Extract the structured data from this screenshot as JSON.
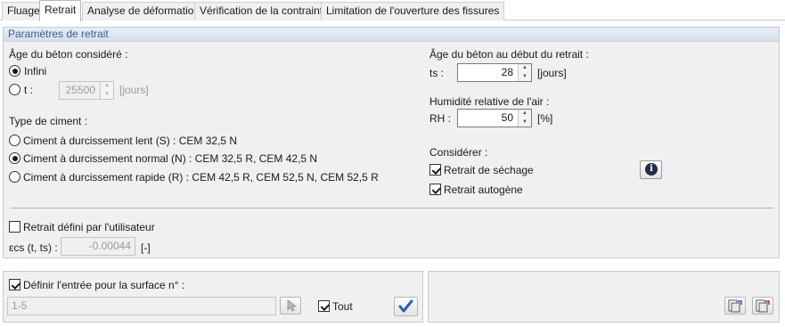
{
  "tabs": [
    {
      "label": "Fluage",
      "active": false
    },
    {
      "label": "Retrait",
      "active": true
    },
    {
      "label": "Analyse de déformation",
      "active": false
    },
    {
      "label": "Vérification de la contrainte",
      "active": false
    },
    {
      "label": "Limitation de l'ouverture des fissures",
      "active": false
    }
  ],
  "params": {
    "header": "Paramètres de retrait",
    "age": {
      "label": "Âge du béton considéré :",
      "infinite_label": "Infini",
      "infinite_selected": true,
      "t_label": "t :",
      "t_value": "25500",
      "t_unit": "[jours]"
    },
    "cement": {
      "label": "Type de ciment :",
      "options": [
        {
          "label": "Ciment à durcissement lent (S) : CEM 32,5 N",
          "selected": false
        },
        {
          "label": "Ciment à durcissement normal (N) : CEM 32,5 R, CEM 42,5 N",
          "selected": true
        },
        {
          "label": "Ciment à durcissement rapide (R) : CEM 42,5 R, CEM 52,5 N, CEM 52,5 R",
          "selected": false
        }
      ]
    },
    "ts": {
      "label": "Âge du béton au début du retrait :",
      "field_label": "ts :",
      "value": "28",
      "unit": "[jours]"
    },
    "rh": {
      "label": "Humidité relative de l'air :",
      "field_label": "RH :",
      "value": "50",
      "unit": "[%]"
    },
    "consider": {
      "label": "Considérer :",
      "drying_label": "Retrait de séchage",
      "drying_checked": true,
      "autogenous_label": "Retrait autogène",
      "autogenous_checked": true,
      "info_icon": "info-icon"
    },
    "user_defined": {
      "label": "Retrait défini par l'utilisateur",
      "checked": false,
      "eps_label": "εcs (t, ts) :",
      "eps_value": "-0.00044",
      "eps_unit": "[-]"
    }
  },
  "surface": {
    "label": "Définir l'entrée pour la surface n° :",
    "checked": true,
    "value": "1-5",
    "all_label": "Tout",
    "all_checked": true
  }
}
